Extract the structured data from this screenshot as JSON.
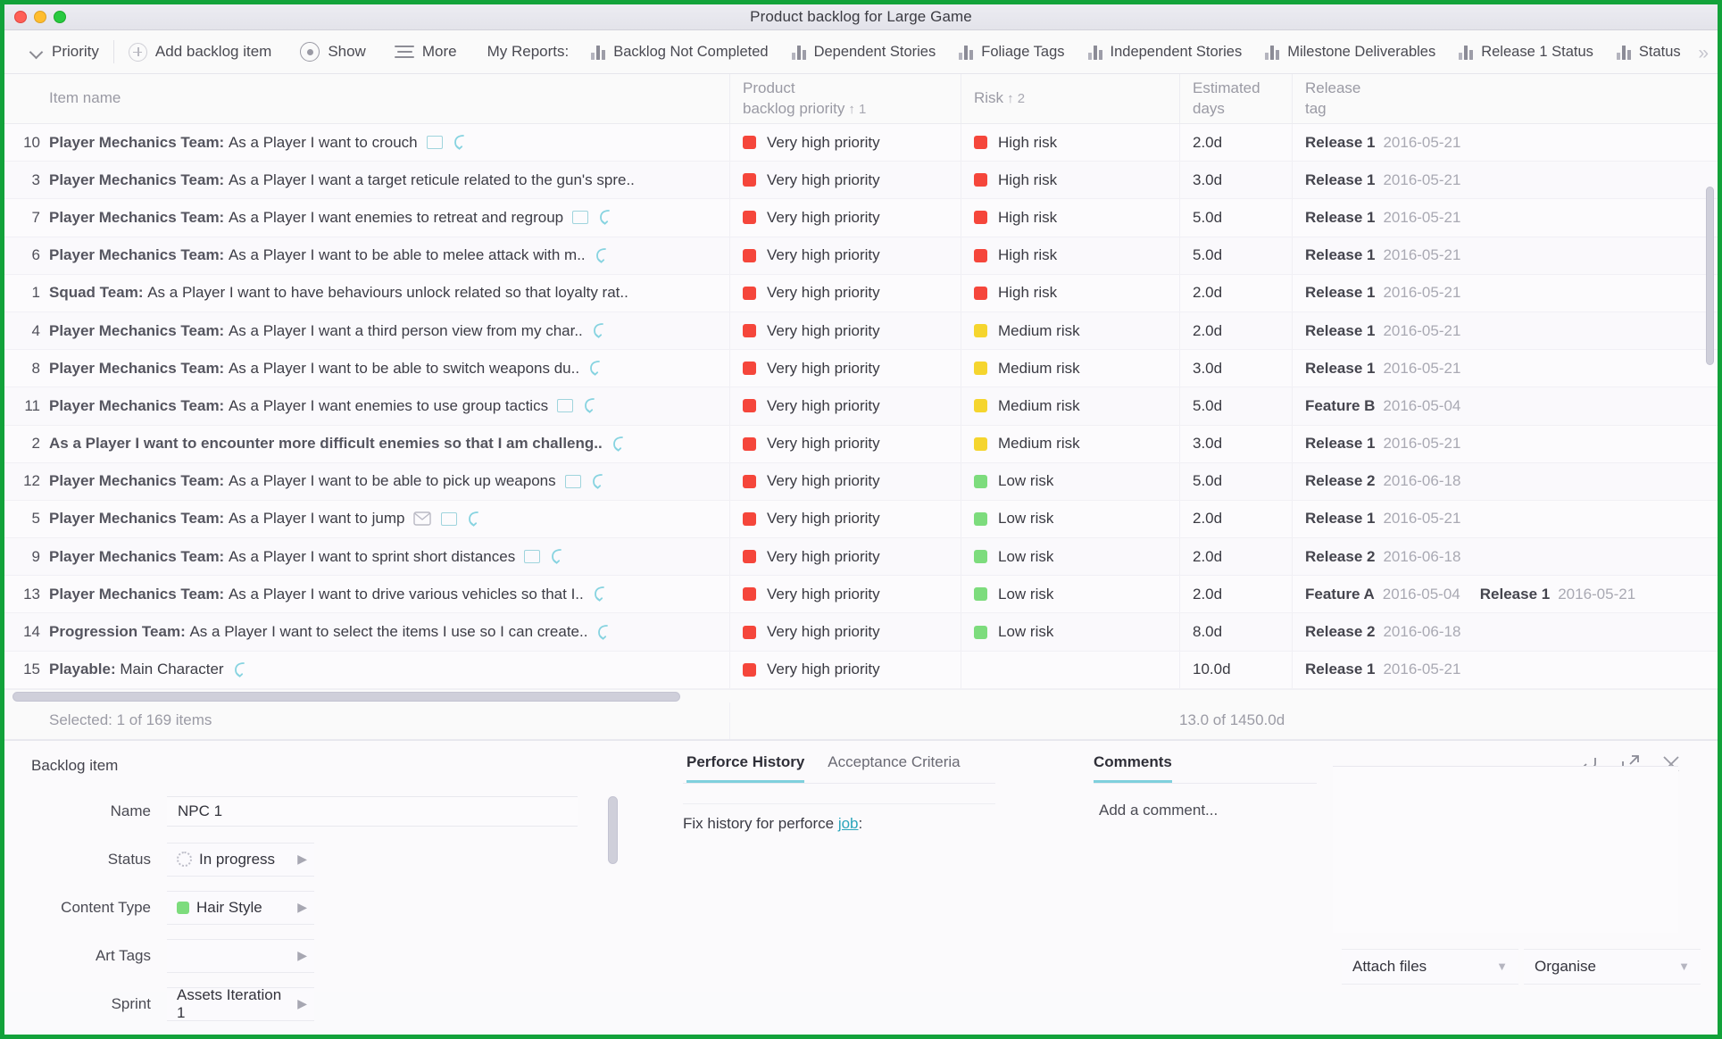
{
  "window": {
    "title": "Product backlog for Large Game",
    "buttons": [
      "close",
      "minimize",
      "maximize"
    ]
  },
  "toolbar": {
    "priority_label": "Priority",
    "add_item_label": "Add backlog item",
    "show_label": "Show",
    "more_label": "More",
    "my_reports_label": "My Reports:",
    "reports": [
      "Backlog Not Completed",
      "Dependent Stories",
      "Foliage Tags",
      "Independent Stories",
      "Milestone Deliverables",
      "Release 1 Status",
      "Status"
    ],
    "overflow": "»"
  },
  "table": {
    "columns": [
      {
        "id": "name",
        "label": "Item name",
        "label2": "",
        "sort": ""
      },
      {
        "id": "priority",
        "label": "Product",
        "label2": "backlog priority",
        "sort": "↑ 1"
      },
      {
        "id": "risk",
        "label": "Risk",
        "label2": "",
        "sort": "↑ 2"
      },
      {
        "id": "days",
        "label": "Estimated",
        "label2": "days",
        "sort": ""
      },
      {
        "id": "release",
        "label": "Release",
        "label2": "tag",
        "sort": ""
      }
    ],
    "rows": [
      {
        "idx": "10",
        "team": "Player Mechanics Team:",
        "story": "As a Player I want to crouch",
        "icons": [
          "note",
          "hook"
        ],
        "priority": "Very high priority",
        "priority_color": "red",
        "risk": "High risk",
        "risk_color": "red",
        "days": "2.0d",
        "releases": [
          {
            "name": "Release 1",
            "date": "2016-05-21"
          }
        ]
      },
      {
        "idx": "3",
        "team": "Player Mechanics Team:",
        "story": "As a Player I want a target reticule related to the gun's spre..",
        "icons": [],
        "priority": "Very high priority",
        "priority_color": "red",
        "risk": "High risk",
        "risk_color": "red",
        "days": "3.0d",
        "releases": [
          {
            "name": "Release 1",
            "date": "2016-05-21"
          }
        ]
      },
      {
        "idx": "7",
        "team": "Player Mechanics Team:",
        "story": "As a Player I want enemies to retreat and regroup",
        "icons": [
          "note",
          "hook"
        ],
        "priority": "Very high priority",
        "priority_color": "red",
        "risk": "High risk",
        "risk_color": "red",
        "days": "5.0d",
        "releases": [
          {
            "name": "Release 1",
            "date": "2016-05-21"
          }
        ]
      },
      {
        "idx": "6",
        "team": "Player Mechanics Team:",
        "story": "As a Player I want to be able to melee attack with m..",
        "icons": [
          "hook"
        ],
        "priority": "Very high priority",
        "priority_color": "red",
        "risk": "High risk",
        "risk_color": "red",
        "days": "5.0d",
        "releases": [
          {
            "name": "Release 1",
            "date": "2016-05-21"
          }
        ]
      },
      {
        "idx": "1",
        "team": "Squad Team:",
        "story": "As a Player I want to have behaviours unlock related so that loyalty rat..",
        "icons": [],
        "priority": "Very high priority",
        "priority_color": "red",
        "risk": "High risk",
        "risk_color": "red",
        "days": "2.0d",
        "releases": [
          {
            "name": "Release 1",
            "date": "2016-05-21"
          }
        ]
      },
      {
        "idx": "4",
        "team": "Player Mechanics Team:",
        "story": "As a Player I want a third person view from my char..",
        "icons": [
          "hook"
        ],
        "priority": "Very high priority",
        "priority_color": "red",
        "risk": "Medium risk",
        "risk_color": "yellow",
        "days": "2.0d",
        "releases": [
          {
            "name": "Release 1",
            "date": "2016-05-21"
          }
        ]
      },
      {
        "idx": "8",
        "team": "Player Mechanics Team:",
        "story": "As a Player I want to be able to switch weapons du..",
        "icons": [
          "hook"
        ],
        "priority": "Very high priority",
        "priority_color": "red",
        "risk": "Medium risk",
        "risk_color": "yellow",
        "days": "3.0d",
        "releases": [
          {
            "name": "Release 1",
            "date": "2016-05-21"
          }
        ]
      },
      {
        "idx": "11",
        "team": "Player Mechanics Team:",
        "story": "As a Player I want enemies to use group tactics",
        "icons": [
          "note",
          "hook"
        ],
        "priority": "Very high priority",
        "priority_color": "red",
        "risk": "Medium risk",
        "risk_color": "yellow",
        "days": "5.0d",
        "releases": [
          {
            "name": "Feature B",
            "date": "2016-05-04"
          }
        ]
      },
      {
        "idx": "2",
        "team": "",
        "story": "As a Player I want to encounter more difficult enemies so that I am challeng..",
        "story_bold": true,
        "icons": [
          "hook"
        ],
        "priority": "Very high priority",
        "priority_color": "red",
        "risk": "Medium risk",
        "risk_color": "yellow",
        "days": "3.0d",
        "releases": [
          {
            "name": "Release 1",
            "date": "2016-05-21"
          }
        ]
      },
      {
        "idx": "12",
        "team": "Player Mechanics Team:",
        "story": "As a Player I want to be able to pick up weapons",
        "icons": [
          "note",
          "hook"
        ],
        "priority": "Very high priority",
        "priority_color": "red",
        "risk": "Low risk",
        "risk_color": "green",
        "days": "5.0d",
        "releases": [
          {
            "name": "Release 2",
            "date": "2016-06-18"
          }
        ]
      },
      {
        "idx": "5",
        "team": "Player Mechanics Team:",
        "story": "As a Player I want to jump",
        "icons": [
          "env",
          "note",
          "hook"
        ],
        "priority": "Very high priority",
        "priority_color": "red",
        "risk": "Low risk",
        "risk_color": "green",
        "days": "2.0d",
        "releases": [
          {
            "name": "Release 1",
            "date": "2016-05-21"
          }
        ]
      },
      {
        "idx": "9",
        "team": "Player Mechanics Team:",
        "story": "As a Player I want to sprint short distances",
        "icons": [
          "note",
          "hook"
        ],
        "priority": "Very high priority",
        "priority_color": "red",
        "risk": "Low risk",
        "risk_color": "green",
        "days": "2.0d",
        "releases": [
          {
            "name": "Release 2",
            "date": "2016-06-18"
          }
        ]
      },
      {
        "idx": "13",
        "team": "Player Mechanics Team:",
        "story": "As a Player I want to drive various vehicles so that I..",
        "icons": [
          "hook"
        ],
        "priority": "Very high priority",
        "priority_color": "red",
        "risk": "Low risk",
        "risk_color": "green",
        "days": "2.0d",
        "releases": [
          {
            "name": "Feature A",
            "date": "2016-05-04"
          },
          {
            "name": "Release 1",
            "date": "2016-05-21"
          }
        ]
      },
      {
        "idx": "14",
        "team": "Progression Team:",
        "story": "As a Player I want to select the items I use so I can create..",
        "icons": [
          "hook"
        ],
        "priority": "Very high priority",
        "priority_color": "red",
        "risk": "Low risk",
        "risk_color": "green",
        "days": "8.0d",
        "releases": [
          {
            "name": "Release 2",
            "date": "2016-06-18"
          }
        ]
      },
      {
        "idx": "15",
        "team": "Playable:",
        "story": "Main Character",
        "icons": [
          "hook"
        ],
        "priority": "Very high priority",
        "priority_color": "red",
        "risk": "",
        "risk_color": "",
        "days": "10.0d",
        "releases": [
          {
            "name": "Release 1",
            "date": "2016-05-21"
          }
        ]
      }
    ]
  },
  "status": {
    "selected": "Selected: 1 of 169 items",
    "days_total": "13.0 of 1450.0d"
  },
  "detail": {
    "panel_title": "Backlog item",
    "fields": [
      {
        "label": "Name",
        "value": "NPC 1",
        "type": "text"
      },
      {
        "label": "Status",
        "value": "In progress",
        "type": "combo",
        "icon": "spinner"
      },
      {
        "label": "Content Type",
        "value": "Hair Style",
        "type": "combo",
        "swatch": "#7ddc7d"
      },
      {
        "label": "Art Tags",
        "value": "",
        "type": "combo"
      },
      {
        "label": "Sprint",
        "value": "Assets Iteration 1",
        "type": "combo"
      }
    ],
    "tabs": [
      {
        "label": "Perforce History",
        "active": true
      },
      {
        "label": "Acceptance Criteria",
        "active": false
      }
    ],
    "history_prefix": "Fix history for perforce ",
    "history_link": "job",
    "history_suffix": ":",
    "comments_label": "Comments",
    "comment_placeholder": "Add a comment...",
    "attach_label": "Attach files",
    "organise_label": "Organise",
    "icons": [
      "return-icon",
      "popout-icon",
      "close-icon"
    ]
  },
  "colors": {
    "red": "#f5463b",
    "yellow": "#f5d52e",
    "green": "#7ddc7d",
    "accent": "#7fd0dd",
    "border_green": "#12a23a"
  }
}
